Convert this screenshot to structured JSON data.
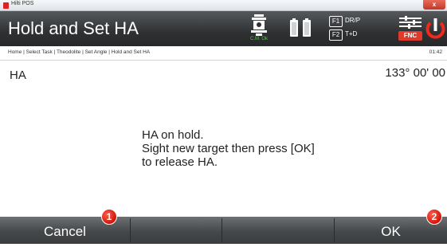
{
  "window": {
    "app_title": "Hilti POS",
    "close_glyph": "x"
  },
  "header": {
    "title": "Hold and Set HA",
    "instrument_status": "C.M. Ok",
    "fkey1": {
      "key": "F1",
      "label": "DR/P"
    },
    "fkey2": {
      "key": "F2",
      "label": "T+D"
    },
    "fnc_label": "FNC"
  },
  "breadcrumb": {
    "path": "Home | Select Task | Theodolite | Set Angle | Hold and Set HA",
    "time": "01:42"
  },
  "main": {
    "ha_label": "HA",
    "ha_value": "133° 00' 00",
    "message_lines": [
      "HA on hold.",
      "Sight new target then press [OK]",
      "to release HA."
    ]
  },
  "footer": {
    "cancel_label": "Cancel",
    "ok_label": "OK"
  },
  "callouts": {
    "one": "1",
    "two": "2"
  },
  "colors": {
    "header_bg": "#2f3133",
    "footer_bg": "#45484a",
    "callout_red": "#d0170b",
    "status_green": "#4cd137",
    "fnc_red": "#e03a2c"
  },
  "icons": [
    "app-icon",
    "instrument-icon",
    "battery-icon",
    "fnc-menu-icon",
    "power-icon"
  ]
}
